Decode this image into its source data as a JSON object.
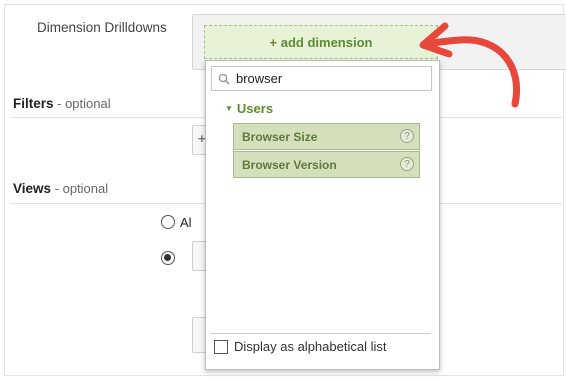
{
  "dimension_drilldowns": {
    "label": "Dimension Drilldowns",
    "add_button": "+ add dimension"
  },
  "filters": {
    "title": "Filters",
    "optional": " - optional"
  },
  "views": {
    "title": "Views",
    "optional": " - optional",
    "radio_all_label_partial": "Al"
  },
  "dropdown": {
    "search_value": "browser",
    "group_label": "Users",
    "items": [
      {
        "label": "Browser Size"
      },
      {
        "label": "Browser Version"
      }
    ],
    "help_glyph": "?",
    "alphabetical_label": "Display as alphabetical list"
  },
  "colors": {
    "accent_green": "#5f8a32",
    "annotation_arrow": "#e8473b"
  }
}
